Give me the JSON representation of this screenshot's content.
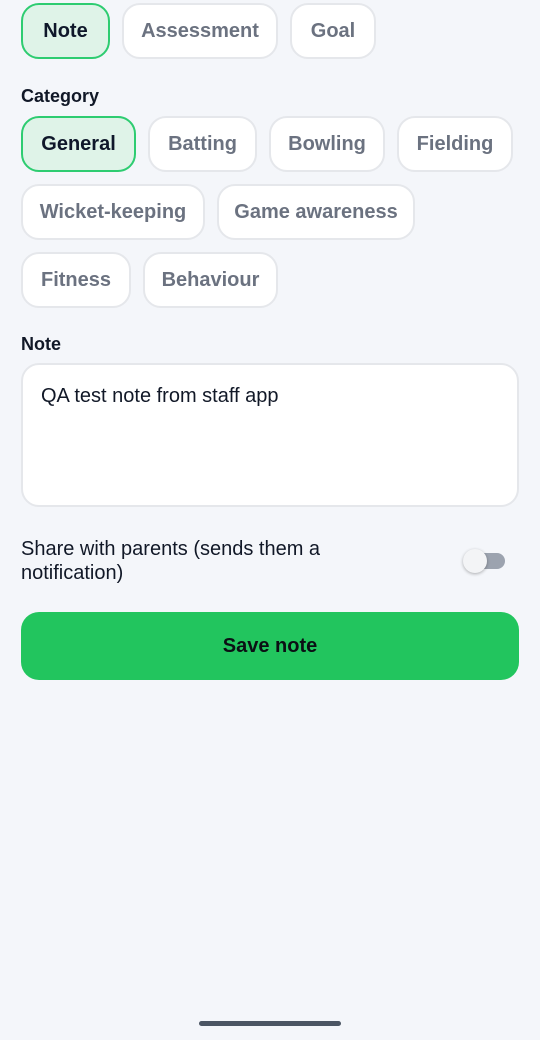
{
  "type_tabs": [
    {
      "label": "Note",
      "selected": true
    },
    {
      "label": "Assessment",
      "selected": false
    },
    {
      "label": "Goal",
      "selected": false
    }
  ],
  "category": {
    "label": "Category",
    "options": [
      {
        "label": "General",
        "selected": true
      },
      {
        "label": "Batting",
        "selected": false
      },
      {
        "label": "Bowling",
        "selected": false
      },
      {
        "label": "Fielding",
        "selected": false
      },
      {
        "label": "Wicket-keeping",
        "selected": false
      },
      {
        "label": "Game awareness",
        "selected": false
      },
      {
        "label": "Fitness",
        "selected": false
      },
      {
        "label": "Behaviour",
        "selected": false
      }
    ]
  },
  "note": {
    "label": "Note",
    "value": "QA test note from staff app"
  },
  "share": {
    "label": "Share with parents (sends them a notification)",
    "enabled": false
  },
  "save_button": {
    "label": "Save note"
  },
  "colors": {
    "accent": "#22c55e",
    "selected_bg": "#dff3e8",
    "selected_border": "#2ecc71",
    "background": "#f4f6fa"
  }
}
